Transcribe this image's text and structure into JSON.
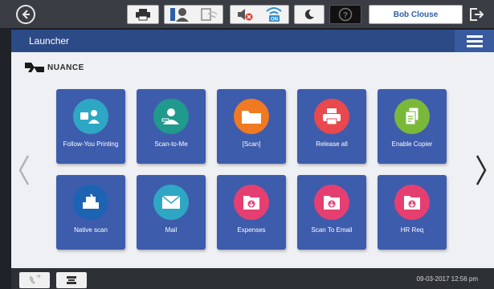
{
  "header": {
    "title": "Launcher"
  },
  "user": {
    "name": "Bob Clouse"
  },
  "brand": {
    "logo_text": "NUANCE"
  },
  "status_icons": [
    "printer-icon",
    "info-person-icon",
    "wifi-status-icon",
    "volume-muted-icon",
    "wifi-on-icon",
    "sleep-moon-icon",
    "help-icon"
  ],
  "tiles": [
    {
      "label": "Follow-You Printing",
      "icon": "follow-you-printing-icon",
      "color": "#2ea7c4"
    },
    {
      "label": "Scan-to-Me",
      "icon": "scan-to-me-icon",
      "color": "#1f9a8c"
    },
    {
      "label": "[Scan]",
      "icon": "folder-icon",
      "color": "#f07a22"
    },
    {
      "label": "Release all",
      "icon": "printer-icon",
      "color": "#e9484d"
    },
    {
      "label": "Enable Copier",
      "icon": "copier-icon",
      "color": "#7ab83a"
    },
    {
      "label": "Native scan",
      "icon": "native-scan-icon",
      "color": "#1c63b3"
    },
    {
      "label": "Mail",
      "icon": "mail-icon",
      "color": "#2ea7c4"
    },
    {
      "label": "Expenses",
      "icon": "document-download-icon",
      "color": "#e53f72"
    },
    {
      "label": "Scan To Email",
      "icon": "document-download-icon",
      "color": "#e53f72"
    },
    {
      "label": "HR Req",
      "icon": "document-download-icon",
      "color": "#e53f72"
    }
  ],
  "footer": {
    "datetime": "09-03-2017 12:56 pm"
  },
  "colors": {
    "tile": "#3e5cac",
    "header": "#2c4a86",
    "background": "#eef0f3"
  }
}
